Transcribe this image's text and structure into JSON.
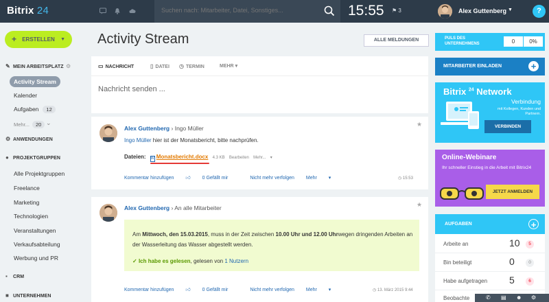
{
  "header": {
    "logo_word": "Bitrix",
    "logo_num": "24",
    "search_placeholder": "Suchen nach: Mitarbeiter, Datei, Sonstiges...",
    "time": "15:55",
    "flag_count": "3",
    "user_name": "Alex Guttenberg",
    "help": "?"
  },
  "sidebar": {
    "create_label": "ERSTELLEN",
    "sections": {
      "workspace": "MEIN ARBEITSPLATZ",
      "apps": "ANWENDUNGEN",
      "projects": "PROJEKTGRUPPEN",
      "crm": "CRM",
      "company": "UNTERNEHMEN"
    },
    "workspace_items": {
      "stream": "Activity Stream",
      "calendar": "Kalender",
      "tasks": "Aufgaben",
      "tasks_count": "12",
      "more": "Mehr...",
      "more_count": "20"
    },
    "groups": [
      "Alle Projektgruppen",
      "Freelance",
      "Marketing",
      "Technologien",
      "Veranstaltungen",
      "Verkaufsabteilung",
      "Werbung und PR"
    ]
  },
  "main": {
    "title": "Activity Stream",
    "filter": "ALLE MELDUNGEN",
    "composer": {
      "tabs": [
        "NACHRICHT",
        "DATEI",
        "TERMIN",
        "MEHR"
      ],
      "placeholder": "Nachricht senden ..."
    },
    "post1": {
      "author": "Alex Guttenberg",
      "recipient": "Ingo Müller",
      "mention": "Ingo Müller",
      "text": " hier ist der Monatsbericht, bitte nachprüfen.",
      "files_label": "Dateien:",
      "file_name": "Monatsbericht.docx",
      "file_size": "4.3 KB",
      "file_edit": "Bearbeiten",
      "file_more": "Mehr...",
      "actions": [
        "Kommentar hinzufügen",
        "0 Gefällt mir",
        "Nicht mehr verfolgen",
        "Mehr"
      ],
      "time": "15:53"
    },
    "post2": {
      "author": "Alex Guttenberg",
      "recipient": "An alle Mitarbeiter",
      "p1": "Am ",
      "p1b": "Mittwoch, den 15.03.2015",
      "p2": ", muss in der Zeit zwischen ",
      "p2b": "10.00 Uhr und 12.00 Uhr",
      "p3": "wegen dringenden Arbeiten an der Wasserleitung das Wasser abgestellt werden.",
      "read_ok": "Ich habe es gelesen",
      "read_by": ", gelesen von ",
      "read_count": "1 Nutzern",
      "actions": [
        "Kommentar hinzufügen",
        "0 Gefällt mir",
        "Nicht mehr verfolgen",
        "Mehr"
      ],
      "time": "13. März 2015 9:44"
    }
  },
  "right": {
    "pulse_label": "PULS DES UNTERNEHMENS",
    "pulse_value": "0",
    "pulse_pct": "0%",
    "invite_label": "MITARBEITER EINLADEN",
    "network": {
      "title": "Bitrix",
      "title_num": "24",
      "title_suffix": "Network",
      "subtitle": "Verbindung",
      "desc": "mit Kollegen, Kunden und Partnern.",
      "button": "VERBINDEN"
    },
    "webinar": {
      "title": "Online-Webinare",
      "desc": "Ihr schneller Einstieg in die Arbeit mit Bitrix24",
      "button": "JETZT ANMELDEN"
    },
    "tasks": {
      "label": "AUFGABEN",
      "rows": [
        {
          "name": "Arbeite an",
          "num": "10",
          "badge": "5"
        },
        {
          "name": "Bin beteiligt",
          "num": "0",
          "badge": "0"
        },
        {
          "name": "Habe aufgetragen",
          "num": "5",
          "badge": "6"
        },
        {
          "name": "Beobachte",
          "num": "",
          "badge": ""
        }
      ]
    }
  }
}
